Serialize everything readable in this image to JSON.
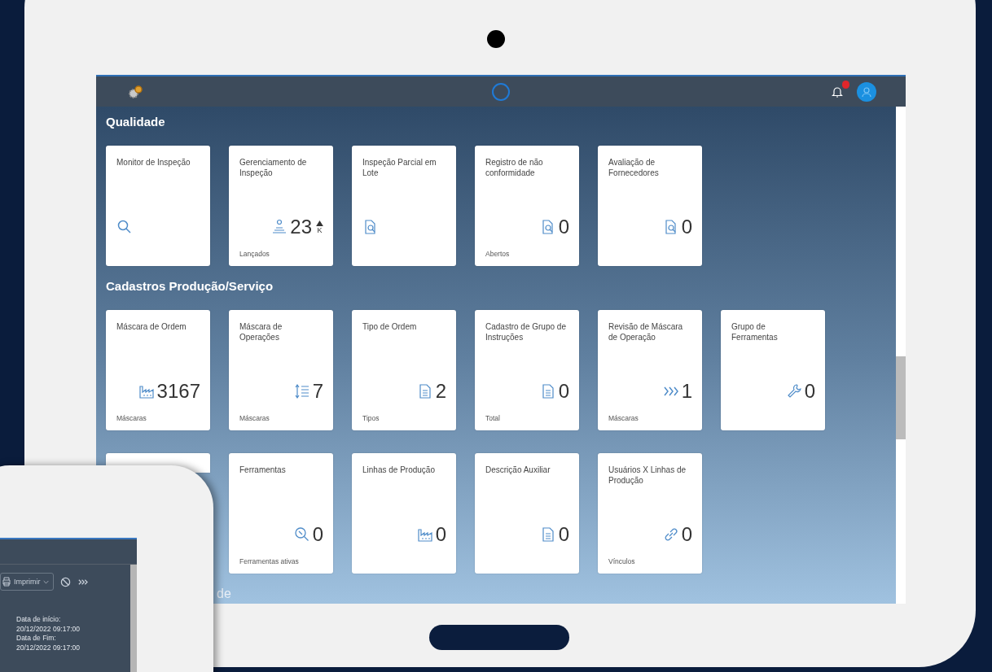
{
  "shell": {
    "notification_count_badge": true
  },
  "sections": [
    {
      "title": "Qualidade",
      "title_covered": false,
      "tiles": [
        {
          "kind": "app",
          "title": "Monitor de Inspeção"
        },
        {
          "kind": "app",
          "title": "Gerenciamento de Inspeção",
          "value": "23",
          "rising": true,
          "unit": "K",
          "footer": "Lançados"
        },
        {
          "kind": "app",
          "title": "Inspeção Parcial em Lote"
        },
        {
          "kind": "app",
          "title": "Registro de não conformidade",
          "value": "0",
          "footer": "Abertos"
        },
        {
          "kind": "app",
          "title": "Avaliação de Fornecedores",
          "value": "0"
        }
      ]
    },
    {
      "title": "Cadastros Produção/Serviço",
      "title_covered": false,
      "tiles": [
        {
          "kind": "app",
          "title": "Máscara de Ordem",
          "value": "3167",
          "footer": "Máscaras"
        },
        {
          "kind": "app",
          "title": "Máscara de Operações",
          "value": "7",
          "footer": "Máscaras"
        },
        {
          "kind": "app",
          "title": "Tipo de Ordem",
          "value": "2",
          "footer": "Tipos"
        },
        {
          "kind": "app",
          "title": "Cadastro de Grupo de Instruções",
          "value": "0",
          "footer": "Total"
        },
        {
          "kind": "app",
          "title": "Revisão de Máscara de Operação",
          "value": "1",
          "footer": "Máscaras"
        },
        {
          "kind": "app",
          "title": "Grupo de Ferramentas",
          "value": "0"
        },
        {
          "kind": "covered"
        },
        {
          "kind": "app",
          "title": "Ferramentas",
          "value": "0",
          "footer": "Ferramentas ativas"
        },
        {
          "kind": "app",
          "title": "Linhas de Produção",
          "value": "0"
        },
        {
          "kind": "app",
          "title": "Descrição Auxiliar",
          "value": "0"
        },
        {
          "kind": "app",
          "title": "Usuários X Linhas de Produção",
          "value": "0",
          "footer": "Vínculos"
        }
      ]
    },
    {
      "title": "de",
      "title_covered": true
    }
  ],
  "phone": {
    "print_button": "Imprimir",
    "fields": [
      "Data de início:",
      "20/12/2022 09:17:00",
      "Data de Fim:",
      "20/12/2022 09:17:00"
    ]
  }
}
